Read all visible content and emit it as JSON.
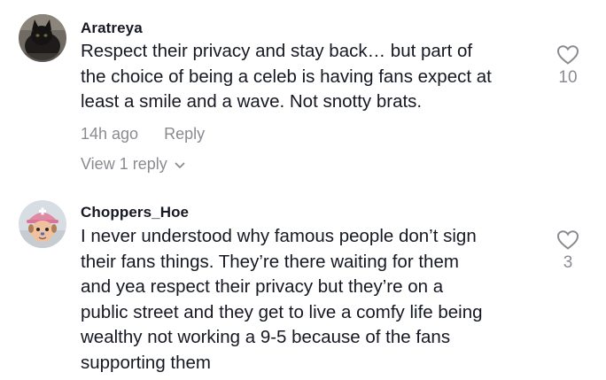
{
  "comments": [
    {
      "username": "Aratreya",
      "lines": [
        "Respect their privacy and stay back… but part of",
        "the choice of being a celeb is having fans expect at",
        "least a smile and a wave. Not snotty brats."
      ],
      "time": "14h ago",
      "reply_label": "Reply",
      "view_replies": "View 1 reply",
      "likes": "10",
      "avatar_icon": "black-cat-avatar",
      "like_icon": "heart-outline-icon"
    },
    {
      "username": "Choppers_Hoe",
      "lines": [
        "I never understood why famous people don’t sign",
        "their fans things. They’re there waiting for them",
        "and yea respect their privacy but they’re on a",
        "public street and they get to live a comfy life being",
        "wealthy not working a 9-5 because of the fans",
        "supporting them"
      ],
      "likes": "3",
      "avatar_icon": "chopper-character-avatar",
      "like_icon": "heart-outline-icon"
    }
  ],
  "colors": {
    "text": "#161823",
    "secondary": "#8a8b91"
  }
}
